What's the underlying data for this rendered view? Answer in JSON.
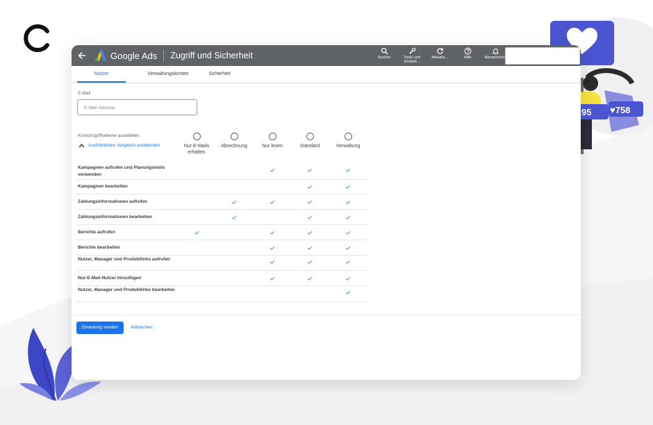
{
  "app": {
    "name": "Google Ads",
    "page_title": "Zugriff und Sicherheit"
  },
  "toolbar": [
    {
      "label": "Suchen",
      "icon": "search-icon"
    },
    {
      "label": "Tools und Einstell...",
      "icon": "wrench-icon"
    },
    {
      "label": "Aktualis...",
      "icon": "refresh-icon"
    },
    {
      "label": "Hilfe",
      "icon": "help-icon"
    },
    {
      "label": "Benachricht.",
      "icon": "bell-icon"
    }
  ],
  "tabs": [
    {
      "label": "Nutzer",
      "active": true
    },
    {
      "label": "Verwaltungskonten",
      "active": false
    },
    {
      "label": "Sicherheit",
      "active": false
    }
  ],
  "email": {
    "label": "E-Mail",
    "placeholder": "E-Mail-Adresse"
  },
  "access": {
    "label": "Kontozugriffsebene auswählen",
    "toggle_label": "Ausführlichen Vergleich ausblenden",
    "levels": [
      {
        "label": "Nur E-Mails erhalten",
        "selected": false
      },
      {
        "label": "Abrechnung",
        "selected": false
      },
      {
        "label": "Nur lesen",
        "selected": false
      },
      {
        "label": "Standard",
        "selected": false
      },
      {
        "label": "Verwaltung",
        "selected": false
      }
    ]
  },
  "permissions": [
    {
      "label": "Kampagnen aufrufen und Planungstools verwenden",
      "checks": [
        false,
        false,
        true,
        true,
        true
      ]
    },
    {
      "label": "Kampagnen bearbeiten",
      "checks": [
        false,
        false,
        false,
        true,
        true
      ]
    },
    {
      "label": "Zahlungsinformationen aufrufen",
      "checks": [
        false,
        true,
        true,
        true,
        true
      ]
    },
    {
      "label": "Zahlungsinformationen bearbeiten",
      "checks": [
        false,
        true,
        false,
        true,
        true
      ]
    },
    {
      "label": "Berichte aufrufen",
      "checks": [
        true,
        false,
        true,
        true,
        true
      ]
    },
    {
      "label": "Berichte bearbeiten",
      "checks": [
        false,
        false,
        true,
        true,
        true
      ]
    },
    {
      "label": "Nutzer, Manager und Produktlinks aufrufen",
      "checks": [
        false,
        false,
        true,
        true,
        true
      ]
    },
    {
      "label": "Nur-E-Mail-Nutzer hinzufügen",
      "checks": [
        false,
        false,
        true,
        true,
        true
      ]
    },
    {
      "label": "Nutzer, Manager und Produktlinks bearbeiten",
      "checks": [
        false,
        false,
        false,
        false,
        true
      ]
    }
  ],
  "actions": {
    "send_label": "Einladung senden",
    "cancel_label": "Abbrechen"
  },
  "decoration": {
    "likes_count": "758",
    "follows_count": "95"
  },
  "colors": {
    "primary": "#1a73e8",
    "topbar": "#5f6368",
    "check": "#34a853",
    "accent_purple": "#5b63d6"
  }
}
